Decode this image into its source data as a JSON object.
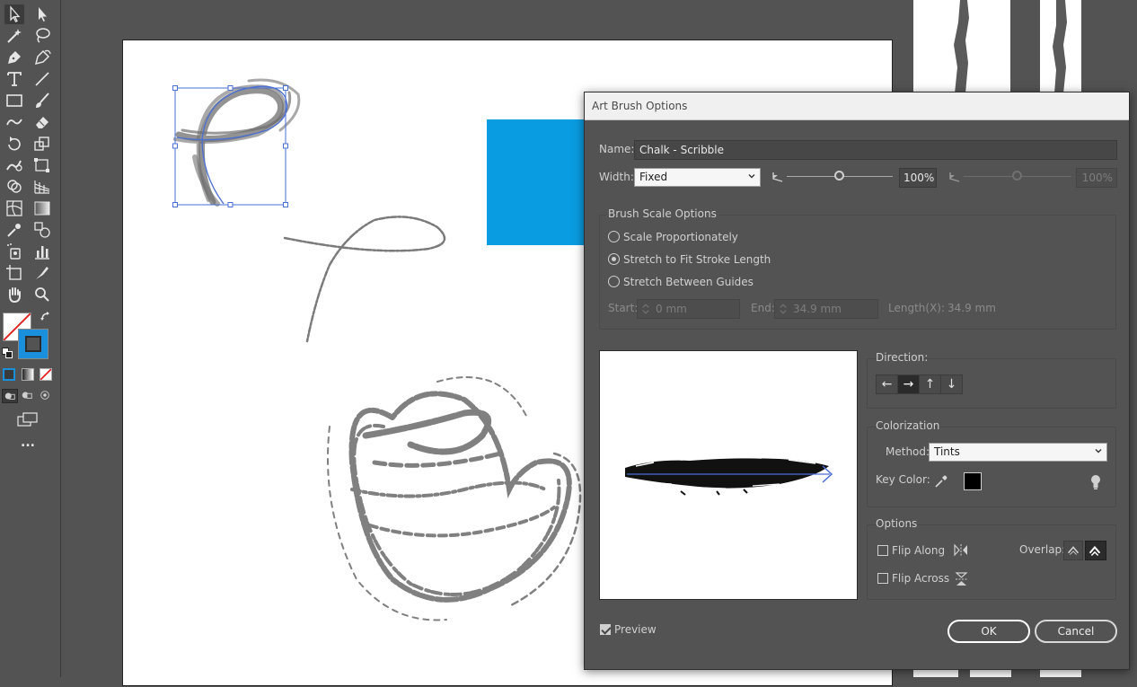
{
  "dialog": {
    "title": "Art Brush Options",
    "name_label": "Name:",
    "name_value": "Chalk - Scribble",
    "width_label": "Width:",
    "width_option": "Fixed",
    "width_percent": "100%",
    "width_percent_disabled": "100%",
    "brush_scale": {
      "legend": "Brush Scale Options",
      "options": [
        "Scale Proportionately",
        "Stretch to Fit Stroke Length",
        "Stretch Between Guides"
      ],
      "selected_index": 1,
      "start_label": "Start:",
      "start_value": "0 mm",
      "end_label": "End:",
      "end_value": "34.9 mm",
      "length_label": "Length(X):",
      "length_value": "34.9 mm"
    },
    "direction": {
      "label": "Direction:",
      "buttons": [
        "←",
        "→",
        "↑",
        "↓"
      ],
      "selected_index": 1
    },
    "colorization": {
      "legend": "Colorization",
      "method_label": "Method:",
      "method_value": "Tints",
      "key_color_label": "Key Color:",
      "key_color": "#000000"
    },
    "options": {
      "legend": "Options",
      "flip_along": "Flip Along",
      "flip_across": "Flip Across",
      "overlap_label": "Overlap:"
    },
    "preview_label": "Preview",
    "preview_checked": true,
    "ok_label": "OK",
    "cancel_label": "Cancel"
  },
  "colors": {
    "accent_blue": "#0a9ce0",
    "path_blue": "#4a6fd4",
    "ui_bg": "#535353"
  },
  "toolbar": {
    "more_label": "..."
  }
}
